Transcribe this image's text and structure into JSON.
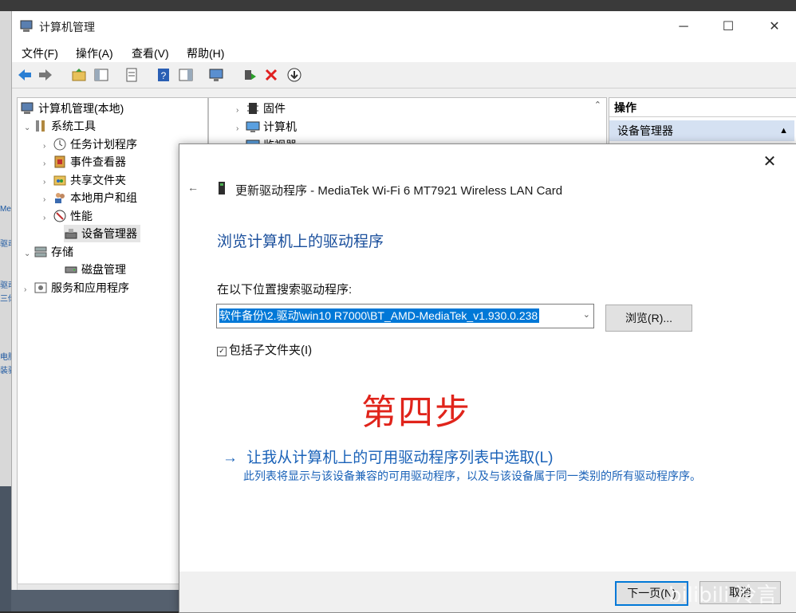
{
  "window": {
    "title": "计算机管理"
  },
  "menu": [
    "文件(F)",
    "操作(A)",
    "查看(V)",
    "帮助(H)"
  ],
  "tree": {
    "root": "计算机管理(本地)",
    "system_tools": "系统工具",
    "task_scheduler": "任务计划程序",
    "event_viewer": "事件查看器",
    "shared_folders": "共享文件夹",
    "local_users": "本地用户和组",
    "performance": "性能",
    "device_manager": "设备管理器",
    "storage": "存储",
    "disk_management": "磁盘管理",
    "services_apps": "服务和应用程序"
  },
  "devices": {
    "firmware": "固件",
    "computer": "计算机",
    "monitor": "监视器"
  },
  "actions": {
    "header": "操作",
    "item": "设备管理器"
  },
  "dialog": {
    "title": "更新驱动程序 - MediaTek Wi-Fi 6 MT7921 Wireless LAN Card",
    "heading": "浏览计算机上的驱动程序",
    "search_label": "在以下位置搜索驱动程序:",
    "path_value": "软件备份\\2.驱动\\win10 R7000\\BT_AMD-MediaTek_v1.930.0.238",
    "browse_label": "浏览(R)...",
    "include_subfolders": "包括子文件夹(I)",
    "step_text": "第四步",
    "pick_link": "让我从计算机上的可用驱动程序列表中选取(L)",
    "pick_desc": "此列表将显示与该设备兼容的可用驱动程序，以及与该设备属于同一类别的所有驱动程序序。",
    "next_label": "下一页(N)",
    "cancel_label": "取消"
  },
  "left_edge": [
    "Me",
    "驱动",
    "驱动",
    "三你",
    "电脑",
    "装驱"
  ],
  "watermark": "bilibili 冷言"
}
